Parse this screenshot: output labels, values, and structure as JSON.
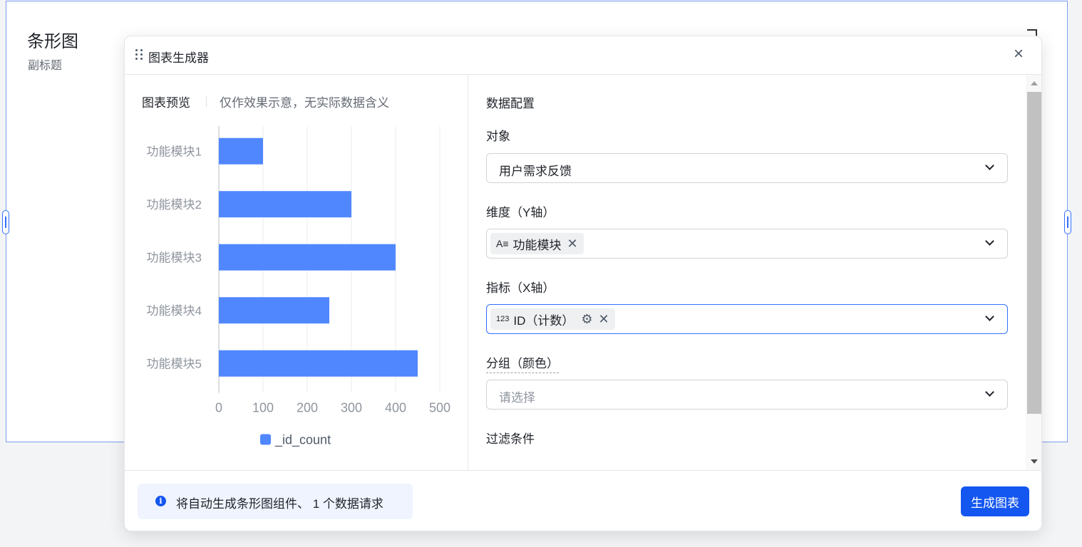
{
  "background_card": {
    "title": "条形图",
    "subtitle": "副标题"
  },
  "modal": {
    "title": "图表生成器",
    "close_label": "×"
  },
  "preview": {
    "title": "图表预览",
    "note": "仅作效果示意，无实际数据含义"
  },
  "chart_data": {
    "type": "bar",
    "orientation": "horizontal",
    "categories": [
      "功能模块1",
      "功能模块2",
      "功能模块3",
      "功能模块4",
      "功能模块5"
    ],
    "series": [
      {
        "name": "_id_count",
        "values": [
          100,
          300,
          400,
          250,
          450
        ]
      }
    ],
    "x_ticks": [
      0,
      100,
      200,
      300,
      400,
      500
    ],
    "xlim": [
      0,
      500
    ],
    "grid": true,
    "legend_position": "bottom",
    "bar_color": "#5087ff"
  },
  "config": {
    "section_title": "数据配置",
    "object_label": "对象",
    "object_value": "用户需求反馈",
    "dimension_label": "维度（Y轴）",
    "dimension_tag_icon": "A≡",
    "dimension_tag": "功能模块",
    "metric_label": "指标（X轴）",
    "metric_tag_icon": "123",
    "metric_tag": "ID（计数）",
    "group_label": "分组（颜色）",
    "group_placeholder": "请选择",
    "filter_label": "过滤条件"
  },
  "footer": {
    "info_icon": "i",
    "info_text": "将自动生成条形图组件、 1 个数据请求",
    "generate_button": "生成图表"
  },
  "colors": {
    "accent": "#1456f0",
    "bar": "#5087ff",
    "card_border": "#7a9ef0"
  }
}
